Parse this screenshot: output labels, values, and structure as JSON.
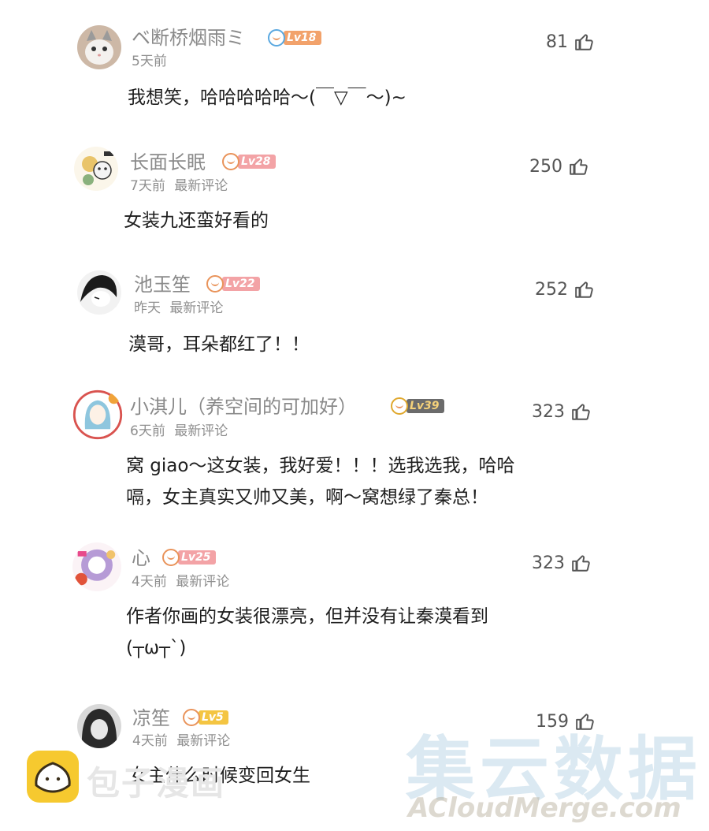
{
  "comments": [
    {
      "username": "ベ断桥烟雨ミ",
      "level": "Lv18",
      "level_color": "#f2a26b",
      "time": "5天前",
      "tag": "",
      "likes": "81",
      "lines": [
        "我想笑，哈哈哈哈哈～(￣▽￣～)~"
      ],
      "avatar": "cat-avatar"
    },
    {
      "username": "长面长眠",
      "level": "Lv28",
      "level_color": "#f3a3a6",
      "time": "7天前",
      "tag": "最新评论",
      "likes": "250",
      "lines": [
        "女装九还蛮好看的"
      ],
      "avatar": "sticker-avatar"
    },
    {
      "username": "池玉笙",
      "level": "Lv22",
      "level_color": "#f3a3a6",
      "time": "昨天",
      "tag": "最新评论",
      "likes": "252",
      "lines": [
        "漠哥，耳朵都红了！！"
      ],
      "avatar": "anime-bw-avatar"
    },
    {
      "username": "小淇儿（养空间的可加好）",
      "level": "Lv39",
      "level_color": "#6b6b6b",
      "time": "6天前",
      "tag": "最新评论",
      "likes": "323",
      "lines": [
        "窝 giao～这女装，我好爱！！！选我选我，哈哈",
        "嗝，女主真实又帅又美，啊～窝想绿了秦总！"
      ],
      "avatar": "anime-girl-avatar"
    },
    {
      "username": "心",
      "level": "Lv25",
      "level_color": "#f3a3a6",
      "time": "4天前",
      "tag": "最新评论",
      "likes": "323",
      "lines": [
        "作者你画的女装很漂亮，但并没有让秦漠看到",
        "(┬ω┬`)"
      ],
      "avatar": "colorful-avatar"
    },
    {
      "username": "凉笙",
      "level": "Lv5",
      "level_color": "#f4c542",
      "time": "4天前",
      "tag": "最新评论",
      "likes": "159",
      "lines": [
        "女主什么时候变回女生"
      ],
      "avatar": "dark-hair-avatar"
    }
  ],
  "footer": {
    "app_name": "包子漫画",
    "watermark": "集云数据",
    "watermark_url": "ACloudMerge.com"
  },
  "colors": {
    "username": "#8a8a8a",
    "meta": "#8f8f8f",
    "text": "#1e1e1e",
    "logo": "#f6c92f"
  }
}
